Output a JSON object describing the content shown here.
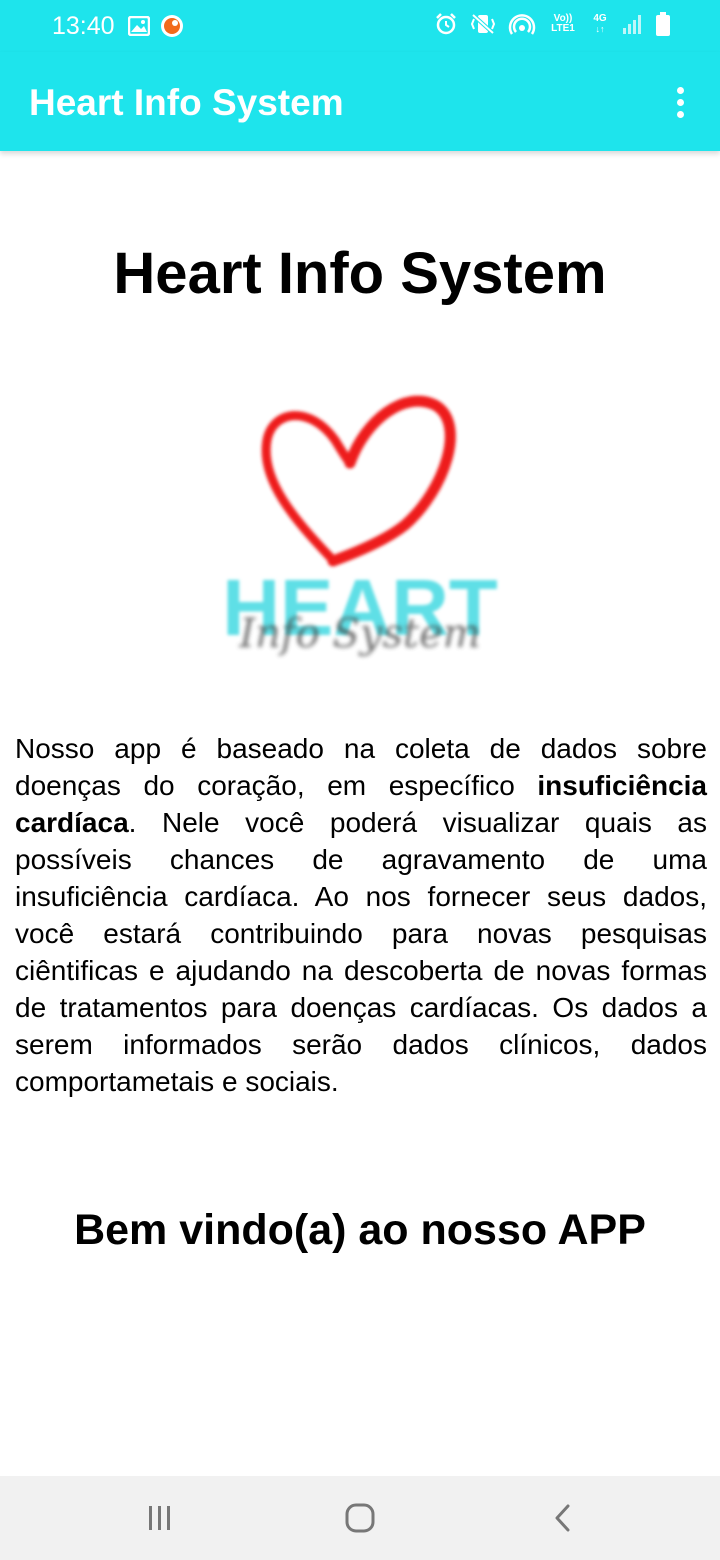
{
  "status_bar": {
    "time": "13:40",
    "left_icons": [
      "image-icon",
      "notification-dot-icon"
    ],
    "right_icons": [
      "alarm-icon",
      "vibrate-icon",
      "hotspot-icon",
      "volte-icon",
      "4g-icon",
      "signal-icon",
      "battery-icon"
    ],
    "volte_label": "Vo)) LTE1",
    "network_label": "4G"
  },
  "app_bar": {
    "title": "Heart Info System",
    "menu_icon": "more-vert-icon",
    "background": "#1ee4ec"
  },
  "main": {
    "heading": "Heart Info System",
    "logo": {
      "word": "HEART",
      "script": "Info System",
      "heart_color": "#ee1c1c",
      "word_color": "#5fdfe6"
    },
    "description": {
      "part1": "Nosso app é baseado na coleta de dados sobre doenças do coração, em específico ",
      "bold": "insuficiência cardíaca",
      "part2": ". Nele você poderá visualizar quais as possíveis chances de agravamento de uma insuficiência cardíaca. Ao nos fornecer seus dados, você estará contribuindo para novas pesquisas ciêntificas e ajudando na descoberta de novas formas de tratamentos para doenças cardíacas. Os dados a serem informados serão dados clínicos, dados comportametais e sociais."
    },
    "welcome": "Bem vindo(a) ao nosso APP"
  },
  "nav_bar": {
    "buttons": [
      "recent-apps-icon",
      "home-icon",
      "back-icon"
    ]
  }
}
